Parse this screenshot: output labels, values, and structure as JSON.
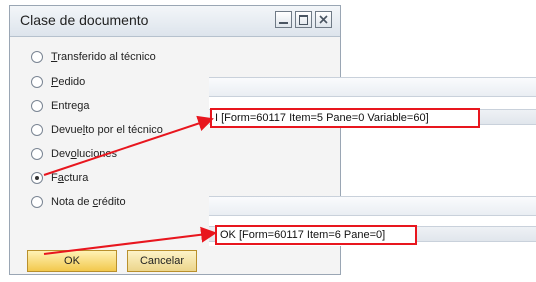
{
  "dialog": {
    "title": "Clase de documento",
    "options": [
      {
        "prefix": "",
        "underline": "T",
        "suffix": "ransferido al técnico",
        "checked": false
      },
      {
        "prefix": "",
        "underline": "P",
        "suffix": "edido",
        "checked": false
      },
      {
        "prefix": "Entrega",
        "underline": "",
        "suffix": "",
        "checked": false
      },
      {
        "prefix": "Devue",
        "underline": "l",
        "suffix": "to por el técnico",
        "checked": false
      },
      {
        "prefix": "Dev",
        "underline": "o",
        "suffix": "luciones",
        "checked": false
      },
      {
        "prefix": "F",
        "underline": "a",
        "suffix": "ctura",
        "checked": true
      },
      {
        "prefix": "Nota de ",
        "underline": "c",
        "suffix": "rédito",
        "checked": false
      }
    ],
    "ok_label": "OK",
    "cancel_label": "Cancelar"
  },
  "status_bar_1": {
    "text": "I [Form=60117 Item=5 Pane=0 Variable=60]"
  },
  "status_bar_2": {
    "text": "OK [Form=60117 Item=6 Pane=0]"
  },
  "colors": {
    "highlight_red": "#e8161e",
    "ok_button": "#f2c84d",
    "cancel_button": "#ecd58b",
    "title_bar": "#dde4ec"
  },
  "icons": [
    "minimize-icon",
    "maximize-icon",
    "close-icon",
    "arrow-pointer-icon"
  ]
}
